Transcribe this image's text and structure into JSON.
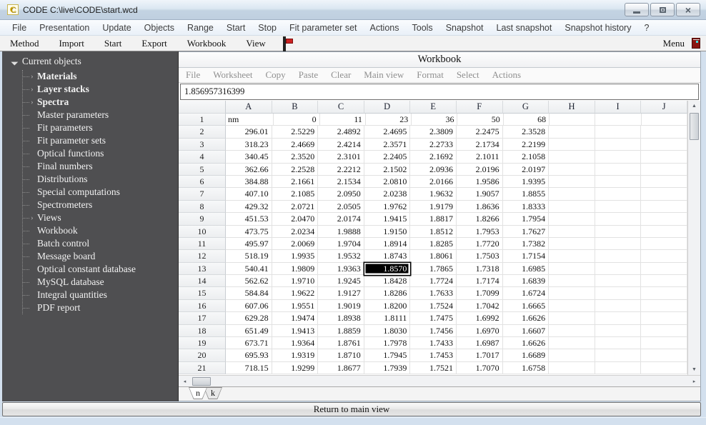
{
  "window": {
    "title": "CODE C:\\live\\CODE\\start.wcd",
    "app_icon_letter": "C"
  },
  "menu_bar": {
    "items": [
      "File",
      "Presentation",
      "Update",
      "Objects",
      "Range",
      "Start",
      "Stop",
      "Fit parameter set",
      "Actions",
      "Tools",
      "Snapshot",
      "Last snapshot",
      "Snapshot history",
      "?"
    ]
  },
  "toolbar": {
    "items": [
      "Method",
      "Import",
      "Start",
      "Export",
      "Workbook",
      "View"
    ],
    "menu_label": "Menu",
    "icons": [
      "monitor-icon",
      "exit-door-icon"
    ]
  },
  "sidebar": {
    "root_label": "Current objects",
    "items": [
      {
        "label": "Materials",
        "bold": true,
        "expandable": true
      },
      {
        "label": "Layer stacks",
        "bold": true,
        "expandable": true
      },
      {
        "label": "Spectra",
        "bold": true,
        "expandable": true
      },
      {
        "label": "Master parameters",
        "bold": false,
        "expandable": false
      },
      {
        "label": "Fit parameters",
        "bold": false,
        "expandable": false
      },
      {
        "label": "Fit parameter sets",
        "bold": false,
        "expandable": false
      },
      {
        "label": "Optical functions",
        "bold": false,
        "expandable": false
      },
      {
        "label": "Final numbers",
        "bold": false,
        "expandable": false
      },
      {
        "label": "Distributions",
        "bold": false,
        "expandable": false
      },
      {
        "label": "Special computations",
        "bold": false,
        "expandable": false
      },
      {
        "label": "Spectrometers",
        "bold": false,
        "expandable": false
      },
      {
        "label": "Views",
        "bold": false,
        "expandable": true
      },
      {
        "label": "Workbook",
        "bold": false,
        "expandable": false
      },
      {
        "label": "Batch control",
        "bold": false,
        "expandable": false
      },
      {
        "label": "Message board",
        "bold": false,
        "expandable": false
      },
      {
        "label": "Optical constant database",
        "bold": false,
        "expandable": false
      },
      {
        "label": "MySQL database",
        "bold": false,
        "expandable": false
      },
      {
        "label": "Integral quantities",
        "bold": false,
        "expandable": false
      },
      {
        "label": "PDF report",
        "bold": false,
        "expandable": false
      }
    ]
  },
  "workbook": {
    "title": "Workbook",
    "menu": [
      "File",
      "Worksheet",
      "Copy",
      "Paste",
      "Clear",
      "Main view",
      "Format",
      "Select",
      "Actions"
    ],
    "formula_bar_value": "1.856957316399",
    "columns": [
      "A",
      "B",
      "C",
      "D",
      "E",
      "F",
      "G",
      "H",
      "I",
      "J"
    ],
    "rows": [
      [
        "nm",
        "0",
        "11",
        "23",
        "36",
        "50",
        "68",
        "",
        "",
        ""
      ],
      [
        "296.01",
        "2.5229",
        "2.4892",
        "2.4695",
        "2.3809",
        "2.2475",
        "2.3528",
        "",
        "",
        ""
      ],
      [
        "318.23",
        "2.4669",
        "2.4214",
        "2.3571",
        "2.2733",
        "2.1734",
        "2.2199",
        "",
        "",
        ""
      ],
      [
        "340.45",
        "2.3520",
        "2.3101",
        "2.2405",
        "2.1692",
        "2.1011",
        "2.1058",
        "",
        "",
        ""
      ],
      [
        "362.66",
        "2.2528",
        "2.2212",
        "2.1502",
        "2.0936",
        "2.0196",
        "2.0197",
        "",
        "",
        ""
      ],
      [
        "384.88",
        "2.1661",
        "2.1534",
        "2.0810",
        "2.0166",
        "1.9586",
        "1.9395",
        "",
        "",
        ""
      ],
      [
        "407.10",
        "2.1085",
        "2.0950",
        "2.0238",
        "1.9632",
        "1.9057",
        "1.8855",
        "",
        "",
        ""
      ],
      [
        "429.32",
        "2.0721",
        "2.0505",
        "1.9762",
        "1.9179",
        "1.8636",
        "1.8333",
        "",
        "",
        ""
      ],
      [
        "451.53",
        "2.0470",
        "2.0174",
        "1.9415",
        "1.8817",
        "1.8266",
        "1.7954",
        "",
        "",
        ""
      ],
      [
        "473.75",
        "2.0234",
        "1.9888",
        "1.9150",
        "1.8512",
        "1.7953",
        "1.7627",
        "",
        "",
        ""
      ],
      [
        "495.97",
        "2.0069",
        "1.9704",
        "1.8914",
        "1.8285",
        "1.7720",
        "1.7382",
        "",
        "",
        ""
      ],
      [
        "518.19",
        "1.9935",
        "1.9532",
        "1.8743",
        "1.8061",
        "1.7503",
        "1.7154",
        "",
        "",
        ""
      ],
      [
        "540.41",
        "1.9809",
        "1.9363",
        "1.8570",
        "1.7865",
        "1.7318",
        "1.6985",
        "",
        "",
        ""
      ],
      [
        "562.62",
        "1.9710",
        "1.9245",
        "1.8428",
        "1.7724",
        "1.7174",
        "1.6839",
        "",
        "",
        ""
      ],
      [
        "584.84",
        "1.9622",
        "1.9127",
        "1.8286",
        "1.7633",
        "1.7099",
        "1.6724",
        "",
        "",
        ""
      ],
      [
        "607.06",
        "1.9551",
        "1.9019",
        "1.8200",
        "1.7524",
        "1.7042",
        "1.6665",
        "",
        "",
        ""
      ],
      [
        "629.28",
        "1.9474",
        "1.8938",
        "1.8111",
        "1.7475",
        "1.6992",
        "1.6626",
        "",
        "",
        ""
      ],
      [
        "651.49",
        "1.9413",
        "1.8859",
        "1.8030",
        "1.7456",
        "1.6970",
        "1.6607",
        "",
        "",
        ""
      ],
      [
        "673.71",
        "1.9364",
        "1.8761",
        "1.7978",
        "1.7433",
        "1.6987",
        "1.6626",
        "",
        "",
        ""
      ],
      [
        "695.93",
        "1.9319",
        "1.8710",
        "1.7945",
        "1.7453",
        "1.7017",
        "1.6689",
        "",
        "",
        ""
      ],
      [
        "718.15",
        "1.9299",
        "1.8677",
        "1.7939",
        "1.7521",
        "1.7070",
        "1.6758",
        "",
        "",
        ""
      ]
    ],
    "selected_cell": {
      "row_number": 13,
      "column": "D",
      "display_value": "1.8570"
    },
    "sheet_tabs": [
      "n",
      "k"
    ],
    "active_tab": "n"
  },
  "footer": {
    "return_button_label": "Return to main view"
  },
  "colors": {
    "sidebar_bg": "#4f4f51",
    "selected_cell_bg": "#000000",
    "selected_cell_text": "#ffffff",
    "titlebar_gradient_top": "#f0f5fa",
    "titlebar_gradient_bottom": "#bfcfe0",
    "frame_blue": "#d3e0ee"
  }
}
